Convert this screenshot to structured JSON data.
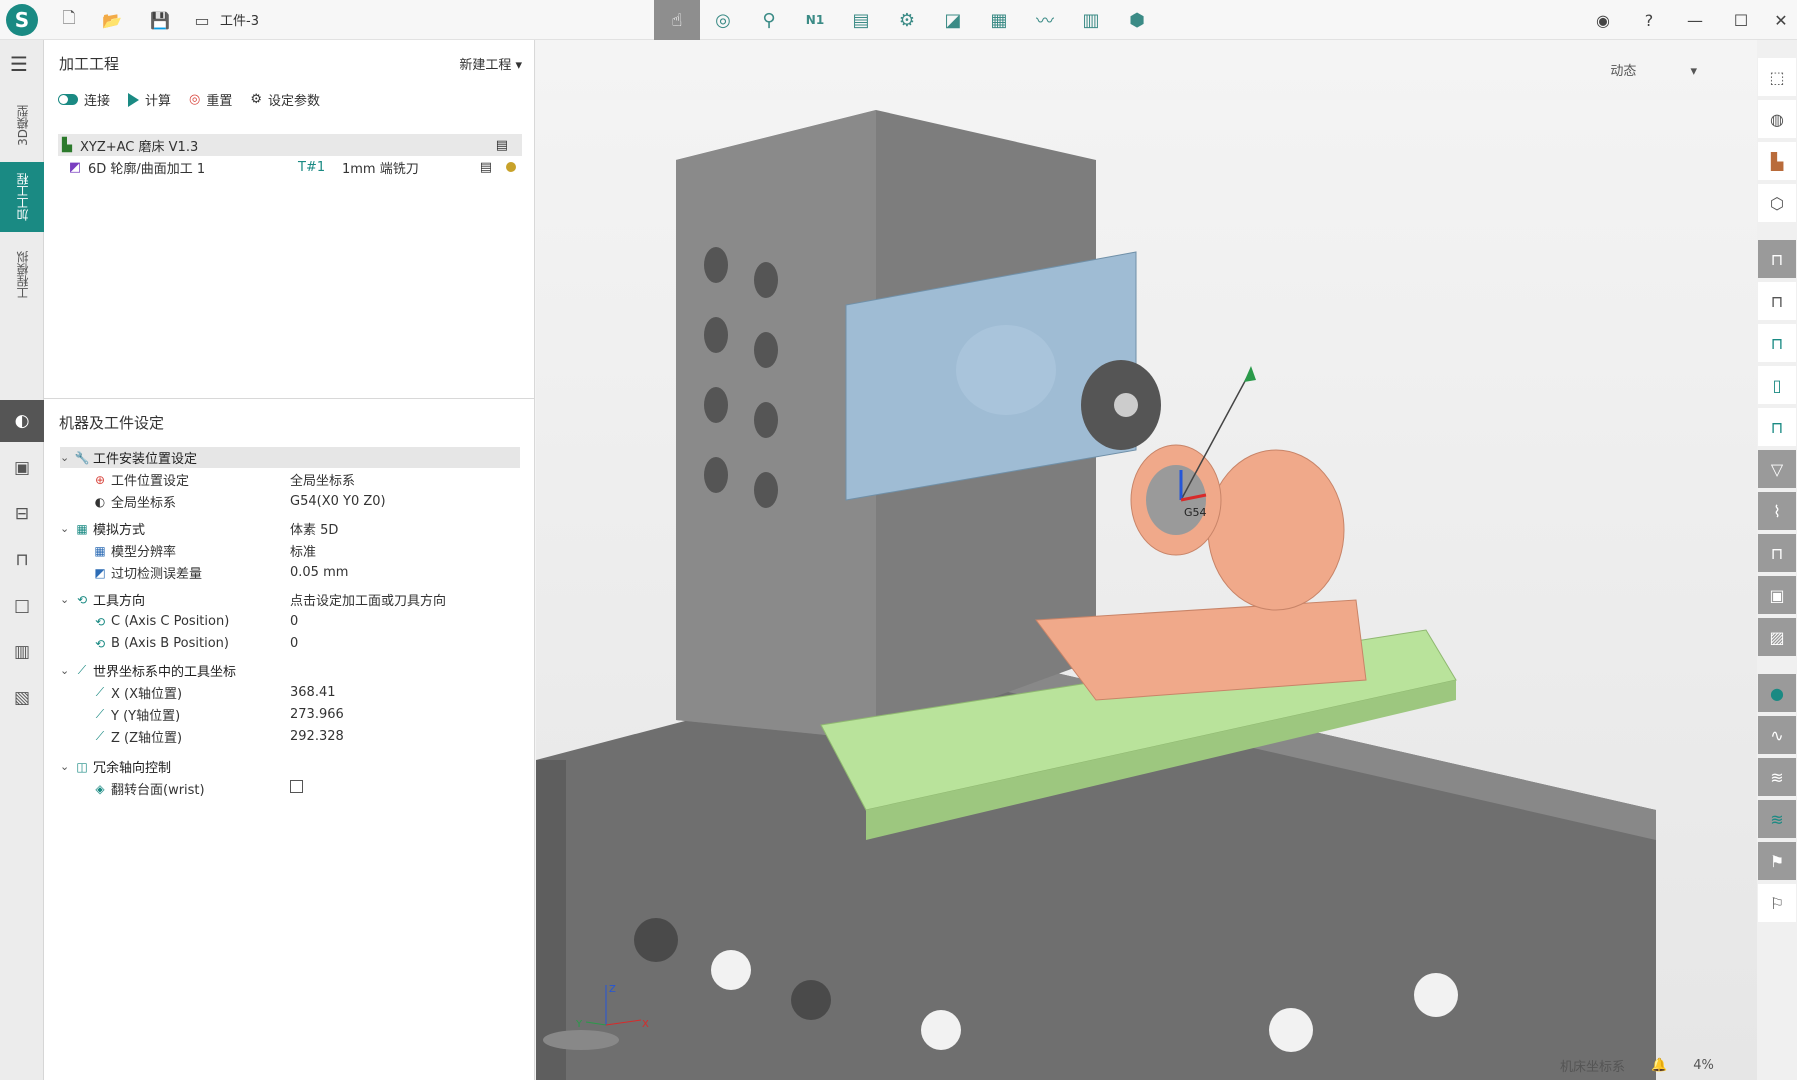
{
  "titlebar": {
    "doc_title": "工件-3",
    "icons": [
      "new-file-icon",
      "open-folder-icon",
      "save-icon",
      "document-icon"
    ],
    "window": {
      "help": "?"
    }
  },
  "ribbon": {
    "icons": [
      "pointer-icon",
      "camera-tool-icon",
      "fixture-icon",
      "nc-program-icon",
      "chart-report-icon",
      "multi-tool-icon",
      "shapes-icon",
      "machine-panel-icon",
      "graph-icon",
      "print-icon",
      "package-icon"
    ],
    "nc_label": "N1"
  },
  "left_rail": {
    "tabs": [
      "3D模型",
      "加工工程",
      "工程模拟"
    ],
    "active_tab": "加工工程"
  },
  "top_panel": {
    "title": "加工工程",
    "new_project": "新建工程",
    "actions": {
      "connect": "连接",
      "compute": "计算",
      "reset": "重置",
      "settings": "设定参数"
    },
    "tree": [
      {
        "label": "XYZ+AC 磨床 V1.3"
      },
      {
        "label": "6D 轮廓/曲面加工 1",
        "tool_no": "T#1",
        "tool": "1mm 端铣刀"
      }
    ]
  },
  "bottom_panel": {
    "title": "机器及工件设定",
    "props": {
      "install_section": "工件安装位置设定",
      "wp_pos_k": "工件位置设定",
      "wp_pos_v": "全局坐标系",
      "global_cs_k": "全局坐标系",
      "global_cs_v": "G54(X0 Y0 Z0)",
      "sim_k": "模拟方式",
      "sim_v": "体素 5D",
      "res_k": "模型分辨率",
      "res_v": "标准",
      "tol_k": "过切检测误差量",
      "tol_v": "0.05 mm",
      "dir_k": "工具方向",
      "dir_v": "点击设定加工面或刀具方向",
      "c_k": "C (Axis C Position)",
      "c_v": "0",
      "b_k": "B (Axis B Position)",
      "b_v": "0",
      "world_k": "世界坐标系中的工具坐标",
      "x_k": "X (X轴位置)",
      "x_v": "368.41",
      "y_k": "Y (Y轴位置)",
      "y_v": "273.966",
      "z_k": "Z (Z轴位置)",
      "z_v": "292.328",
      "redund_k": "冗余轴向控制",
      "wrist_k": "翻转台面(wrist)"
    }
  },
  "viewport": {
    "mode": "动态",
    "g54": "G54",
    "axis_x": "X",
    "axis_y": "Y",
    "axis_z": "Z"
  },
  "status": {
    "coord": "机床坐标系",
    "zoom": "4%"
  },
  "colors": {
    "accent": "#1a8a83",
    "machine": "#7a7a7a",
    "plate": "#9fbcd4",
    "table": "#b9e39b",
    "workpiece": "#f0a98a"
  }
}
